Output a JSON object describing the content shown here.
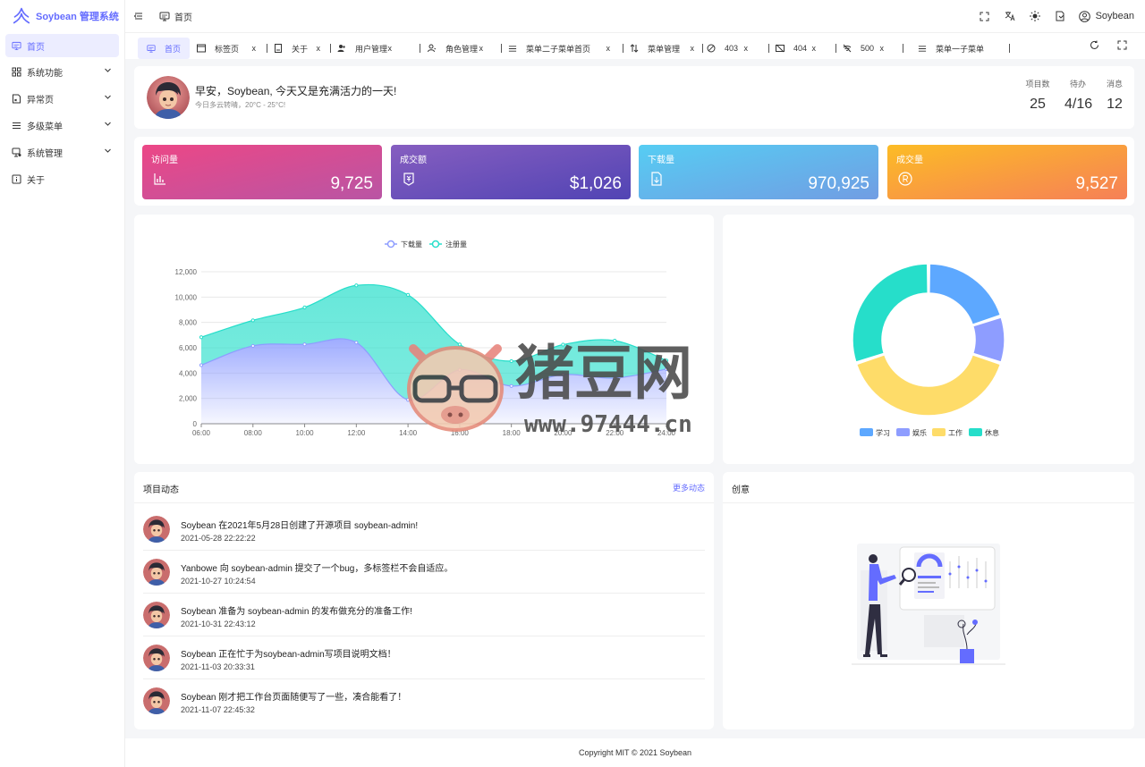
{
  "app": {
    "title": "Soybean 管理系统",
    "brand_color": "#646cff"
  },
  "sidebar": {
    "items": [
      {
        "label": "首页",
        "icon": "monitor-icon",
        "active": true,
        "expandable": false
      },
      {
        "label": "系统功能",
        "icon": "grid-icon",
        "active": false,
        "expandable": true
      },
      {
        "label": "异常页",
        "icon": "page-error-icon",
        "active": false,
        "expandable": true
      },
      {
        "label": "多级菜单",
        "icon": "menu-lines-icon",
        "active": false,
        "expandable": true
      },
      {
        "label": "系统管理",
        "icon": "settings-screen-icon",
        "active": false,
        "expandable": true
      },
      {
        "label": "关于",
        "icon": "info-icon",
        "active": false,
        "expandable": false
      }
    ]
  },
  "header": {
    "breadcrumb": "首页",
    "user_name": "Soybean",
    "icons": [
      "fullscreen-icon",
      "translate-icon",
      "sun-icon",
      "theme-config-icon",
      "user-circle-icon"
    ]
  },
  "tabs": [
    {
      "label": "首页",
      "icon": "monitor-icon",
      "active": true,
      "closable": false
    },
    {
      "label": "标签页",
      "icon": "window-icon",
      "active": false,
      "closable": true
    },
    {
      "label": "关于",
      "icon": "document-icon",
      "active": false,
      "closable": true
    },
    {
      "label": "用户管理",
      "icon": "users-icon",
      "active": false,
      "closable": true
    },
    {
      "label": "角色管理",
      "icon": "user-role-icon",
      "active": false,
      "closable": true
    },
    {
      "label": "菜单二子菜单首页",
      "icon": "menu-lines-icon",
      "active": false,
      "closable": true
    },
    {
      "label": "菜单管理",
      "icon": "sort-icon",
      "active": false,
      "closable": true
    },
    {
      "label": "403",
      "icon": "forbidden-icon",
      "active": false,
      "closable": true
    },
    {
      "label": "404",
      "icon": "not-found-icon",
      "active": false,
      "closable": true
    },
    {
      "label": "500",
      "icon": "wifi-off-icon",
      "active": false,
      "closable": true
    },
    {
      "label": "菜单一子菜单",
      "icon": "menu-lines-icon",
      "active": false,
      "closable": false
    }
  ],
  "tab_close_glyph": "x",
  "welcome": {
    "greeting": "早安，Soybean, 今天又是充满活力的一天!",
    "weather": "今日多云转晴，20°C - 25°C!",
    "stats": [
      {
        "label": "项目数",
        "value": "25"
      },
      {
        "label": "待办",
        "value": "4/16"
      },
      {
        "label": "消息",
        "value": "12"
      }
    ]
  },
  "metrics": [
    {
      "label": "访问量",
      "value": "9,725",
      "icon": "bar-chart-icon",
      "from": "#ec4786",
      "to": "#b955a4"
    },
    {
      "label": "成交额",
      "value": "$1,026",
      "icon": "money-bag-icon",
      "from": "#865ec0",
      "to": "#5144b4"
    },
    {
      "label": "下载量",
      "value": "970,925",
      "icon": "download-file-icon",
      "from": "#56cdf3",
      "to": "#719de3"
    },
    {
      "label": "成交量",
      "value": "9,527",
      "icon": "registered-icon",
      "from": "#fcbc25",
      "to": "#f68057"
    }
  ],
  "chart_data": [
    {
      "type": "area",
      "x": [
        "06:00",
        "08:00",
        "10:00",
        "12:00",
        "14:00",
        "16:00",
        "18:00",
        "20:00",
        "22:00",
        "24:00"
      ],
      "series": [
        {
          "name": "下载量",
          "color": "#8e9dff",
          "values": [
            4623,
            6145,
            6268,
            6411,
            1890,
            4251,
            2978,
            3880,
            3606,
            4311
          ]
        },
        {
          "name": "注册量",
          "color": "#26deca",
          "values": [
            2208,
            2016,
            2916,
            4512,
            8281,
            2008,
            1963,
            2367,
            2956,
            678
          ]
        }
      ],
      "stacked": true,
      "ylim": [
        0,
        12000
      ],
      "yticks": [
        "0",
        "2,000",
        "4,000",
        "6,000",
        "8,000",
        "10,000",
        "12,000"
      ],
      "legend": "top-center",
      "grid": true
    },
    {
      "type": "pie",
      "donut": true,
      "categories": [
        "学习",
        "娱乐",
        "工作",
        "休息"
      ],
      "values": [
        20,
        10,
        40,
        30
      ],
      "colors": [
        "#5da8ff",
        "#8e9dff",
        "#fedc69",
        "#26deca"
      ],
      "legend": "bottom-center"
    }
  ],
  "activity": {
    "title": "项目动态",
    "more": "更多动态",
    "items": [
      {
        "text": "Soybean 在2021年5月28日创建了开源项目 soybean-admin!",
        "time": "2021-05-28 22:22:22"
      },
      {
        "text": "Yanbowe 向 soybean-admin 提交了一个bug，多标签栏不会自适应。",
        "time": "2021-10-27 10:24:54"
      },
      {
        "text": "Soybean 准备为 soybean-admin 的发布做充分的准备工作!",
        "time": "2021-10-31 22:43:12"
      },
      {
        "text": "Soybean 正在忙于为soybean-admin写项目说明文档！",
        "time": "2021-11-03 20:33:31"
      },
      {
        "text": "Soybean 刚才把工作台页面随便写了一些，凑合能看了！",
        "time": "2021-11-07 22:45:32"
      }
    ]
  },
  "creative": {
    "title": "创意"
  },
  "footer": {
    "copyright": "Copyright MIT © 2021 Soybean"
  },
  "watermark": {
    "title": "猪豆网",
    "url": "www.97444.cn"
  }
}
